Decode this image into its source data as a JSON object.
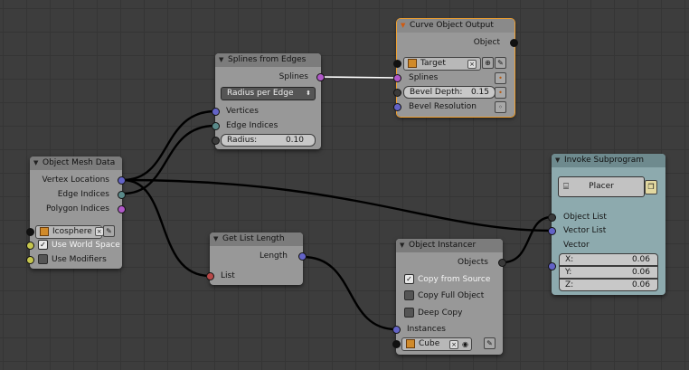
{
  "nodes": {
    "object_mesh_data": {
      "title": "Object Mesh Data",
      "outputs": [
        "Vertex Locations",
        "Edge Indices",
        "Polygon Indices"
      ],
      "object_name": "Icosphere",
      "use_world_space_label": "Use World Space",
      "use_world_space": true,
      "use_modifiers_label": "Use Modifiers",
      "use_modifiers": false
    },
    "splines_from_edges": {
      "title": "Splines from Edges",
      "output": "Splines",
      "mode": "Radius per Edge",
      "inputs": [
        "Vertices",
        "Edge Indices"
      ],
      "radius_label": "Radius:",
      "radius_value": "0.10"
    },
    "curve_object_output": {
      "title": "Curve Object Output",
      "output": "Object",
      "target_name": "Target",
      "splines_label": "Splines",
      "bevel_depth_label": "Bevel Depth:",
      "bevel_depth_value": "0.15",
      "bevel_resolution_label": "Bevel Resolution"
    },
    "get_list_length": {
      "title": "Get List Length",
      "output": "Length",
      "input": "List"
    },
    "object_instancer": {
      "title": "Object Instancer",
      "output": "Objects",
      "copy_from_source_label": "Copy from Source",
      "copy_from_source": true,
      "copy_full_object_label": "Copy Full Object",
      "copy_full_object": false,
      "deep_copy_label": "Deep Copy",
      "deep_copy": false,
      "instances_label": "Instances",
      "object_name": "Cube"
    },
    "invoke_subprogram": {
      "title": "Invoke Subprogram",
      "program": "Placer",
      "inputs": [
        "Object List",
        "Vector List"
      ],
      "vector_label": "Vector",
      "x_label": "X:",
      "x_value": "0.06",
      "y_label": "Y:",
      "y_value": "0.06",
      "z_label": "Z:",
      "z_value": "0.06"
    }
  },
  "colors": {
    "vector_socket": "#6363c7",
    "integer_list_socket": "#5a8a8a",
    "spline_socket": "#b058c8",
    "boolean_socket": "#c6c64e",
    "generic_list_socket": "#b84848",
    "object_socket": "#111111",
    "active_node_outline": "#f0a030"
  }
}
